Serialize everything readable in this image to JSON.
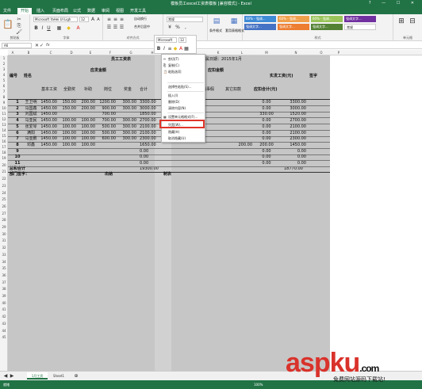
{
  "window": {
    "title": "模板员工excel工资表模板 [兼容模式] - Excel",
    "controls": [
      "?",
      "—",
      "☐",
      "✕"
    ]
  },
  "tabs": [
    "文件",
    "开始",
    "插入",
    "页面布局",
    "公式",
    "数据",
    "审阅",
    "视图",
    "开发工具"
  ],
  "ribbon": {
    "groups": {
      "clipboard": "剪贴板",
      "font": "字体",
      "alignment": "对齐方式",
      "styles": "样式",
      "editing": "单元格"
    },
    "font_name": "Microsoft YaHei UI Ligh",
    "font_size": "12",
    "number_format": "常规",
    "wrap_label": "自动换行",
    "merge_label": "合并后居中",
    "cond_format": "条件格式",
    "table_format": "套用表格格式",
    "styles": [
      {
        "label": "60% - 强调...",
        "color": "#3e8bd6"
      },
      {
        "label": "60% - 强调...",
        "color": "#f0a04b"
      },
      {
        "label": "60% - 强调...",
        "color": "#9ac45a"
      },
      {
        "label": "强调文字...",
        "color": "#7030a0"
      },
      {
        "label": "强调文字...",
        "color": "#4472c4"
      },
      {
        "label": "强调文字...",
        "color": "#ed7d31"
      },
      {
        "label": "强调文字...",
        "color": "#548235"
      },
      {
        "label": "常规",
        "color": "#ffffff"
      }
    ]
  },
  "formula_bar": {
    "name_box": "A6",
    "fx": "fx"
  },
  "mini_toolbar": {
    "font": "Microsoft",
    "size": "12"
  },
  "columns": [
    "A",
    "B",
    "C",
    "D",
    "E",
    "F",
    "G",
    "H",
    "I",
    "J",
    "K",
    "L",
    "M",
    "N",
    "O",
    "P"
  ],
  "rows": [
    "1",
    "2",
    "3",
    "4",
    "5",
    "6",
    "7",
    "8",
    "9",
    "10",
    "11",
    "12",
    "13",
    "14",
    "15",
    "16",
    "17",
    "18",
    "19",
    "20",
    "21",
    "22",
    "23",
    "24",
    "25",
    "26",
    "27",
    "28",
    "29",
    "30",
    "31",
    "32",
    "33",
    "34",
    "35",
    "36",
    "37",
    "38",
    "39",
    "40",
    "41",
    "42",
    "43",
    "44",
    "45"
  ],
  "sheet": {
    "title_left": "员工工资表",
    "title_right": "所属日期：2015年1月",
    "hdr_no": "编号",
    "hdr_name": "姓名",
    "hdr_payable": "应发金额",
    "hdr_deduct": "应扣金额",
    "hdr_actual": "实发工资(元)",
    "hdr_sign": "签字",
    "sub_headers": [
      "基本工资",
      "全勤奖",
      "补助",
      "岗位",
      "奖金",
      "合计"
    ],
    "sub_deduct": [
      "扣病事假",
      "其它扣款",
      "应扣合计(元)"
    ],
    "employees": [
      {
        "no": "1",
        "name": "王卫明",
        "base": "1450.00",
        "att": "150.00",
        "sub": "200.00",
        "post": "1200.00",
        "bonus": "300.00",
        "total": "3300.00",
        "other": "",
        "dtotal": "0.00",
        "actual": "3300.00"
      },
      {
        "no": "2",
        "name": "马国鑫",
        "base": "1450.00",
        "att": "150.00",
        "sub": "200.00",
        "post": "900.00",
        "bonus": "300.00",
        "total": "3000.00",
        "other": "",
        "dtotal": "0.00",
        "actual": "3000.00"
      },
      {
        "no": "3",
        "name": "刘国斌",
        "base": "1450.00",
        "att": "",
        "sub": "",
        "post": "700.00",
        "bonus": "",
        "total": "1850.00",
        "other": "",
        "dtotal": "330.00",
        "actual": "1520.00"
      },
      {
        "no": "4",
        "name": "马亚民",
        "base": "1450.00",
        "att": "100.00",
        "sub": "100.00",
        "post": "700.00",
        "bonus": "300.00",
        "total": "2700.00",
        "other": "",
        "dtotal": "0.00",
        "actual": "2700.00"
      },
      {
        "no": "5",
        "name": "张爱琴",
        "base": "1450.00",
        "att": "100.00",
        "sub": "100.00",
        "post": "500.00",
        "bonus": "300.00",
        "total": "2100.00",
        "other": "",
        "dtotal": "0.00",
        "actual": "2100.00"
      },
      {
        "no": "6",
        "name": "满阳",
        "base": "1450.00",
        "att": "100.00",
        "sub": "100.00",
        "post": "500.00",
        "bonus": "300.00",
        "total": "2100.00",
        "other": "",
        "dtotal": "0.00",
        "actual": "2100.00"
      },
      {
        "no": "7",
        "name": "马亚鹏",
        "base": "1450.00",
        "att": "100.00",
        "sub": "100.00",
        "post": "600.00",
        "bonus": "300.00",
        "total": "2300.00",
        "other": "",
        "dtotal": "0.00",
        "actual": "2300.00"
      },
      {
        "no": "8",
        "name": "邓鑫",
        "base": "1450.00",
        "att": "100.00",
        "sub": "100.00",
        "post": "",
        "bonus": "",
        "total": "1650.00",
        "other": "200.00",
        "dtotal": "200.00",
        "actual": "1450.00"
      },
      {
        "no": "9",
        "name": "",
        "base": "",
        "att": "",
        "sub": "",
        "post": "",
        "bonus": "",
        "total": "0.00",
        "other": "",
        "dtotal": "0.00",
        "actual": "0.00"
      },
      {
        "no": "10",
        "name": "",
        "base": "",
        "att": "",
        "sub": "",
        "post": "",
        "bonus": "",
        "total": "0.00",
        "other": "",
        "dtotal": "0.00",
        "actual": "0.00"
      },
      {
        "no": "11",
        "name": "",
        "base": "",
        "att": "",
        "sub": "",
        "post": "",
        "bonus": "",
        "total": "0.00",
        "other": "",
        "dtotal": "0.00",
        "actual": "0.00"
      }
    ],
    "total_label": "总和合计",
    "total_value": "19300.00",
    "total_actual": "18770.00",
    "footer": {
      "manager": "部门签字：",
      "cashier": "出纳",
      "maker": "制表"
    }
  },
  "context_menu": {
    "items": [
      {
        "icon": "✂",
        "label": "剪切(T)"
      },
      {
        "icon": "⎘",
        "label": "复制(C)"
      },
      {
        "icon": "📋",
        "label": "粘贴选项:"
      },
      {
        "icon": "",
        "label": "选择性粘贴(S)..."
      },
      {
        "icon": "",
        "label": "插入(I)"
      },
      {
        "icon": "",
        "label": "删除(D)"
      },
      {
        "icon": "",
        "label": "清除内容(N)"
      },
      {
        "icon": "▦",
        "label": "设置单元格格式(F)..."
      },
      {
        "icon": "",
        "label": "列宽(W)..."
      },
      {
        "icon": "",
        "label": "隐藏(H)"
      },
      {
        "icon": "",
        "label": "取消隐藏(U)"
      }
    ]
  },
  "sheet_tabs": [
    "1月工资",
    "Sheet1"
  ],
  "status": {
    "left": "就绪",
    "zoom": "100%"
  },
  "watermark": {
    "big": "aspku",
    "domain": ".com",
    "small": "免费网站源码下载站!"
  }
}
